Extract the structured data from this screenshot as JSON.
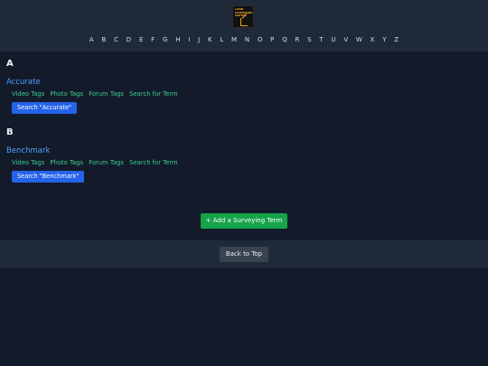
{
  "header": {
    "logo_text": "LAND SURVEYING UNITED",
    "alphabet": [
      "A",
      "B",
      "C",
      "D",
      "E",
      "F",
      "G",
      "H",
      "I",
      "J",
      "K",
      "L",
      "M",
      "N",
      "O",
      "P",
      "Q",
      "R",
      "S",
      "T",
      "U",
      "V",
      "W",
      "X",
      "Y",
      "Z"
    ]
  },
  "sections": [
    {
      "letter": "A",
      "term": "Accurate",
      "links": [
        "Video Tags",
        "Photo Tags",
        "Forum Tags",
        "Search for Term"
      ],
      "search_label": "Search \"Accurate\""
    },
    {
      "letter": "B",
      "term": "Benchmark",
      "links": [
        "Video Tags",
        "Photo Tags",
        "Forum Tags",
        "Search for Term"
      ],
      "search_label": "Search \"Benchmark\""
    }
  ],
  "add_button_label": "+ Add a Surveying Term",
  "back_to_top_label": "Back to Top",
  "colors": {
    "background": "#131a2a",
    "header": "#1e2a38",
    "term_link": "#4aa3ff",
    "tag_link": "#3fcf8e",
    "primary_button": "#2563eb",
    "success_button": "#16a34a",
    "secondary_button": "#3a4450"
  }
}
